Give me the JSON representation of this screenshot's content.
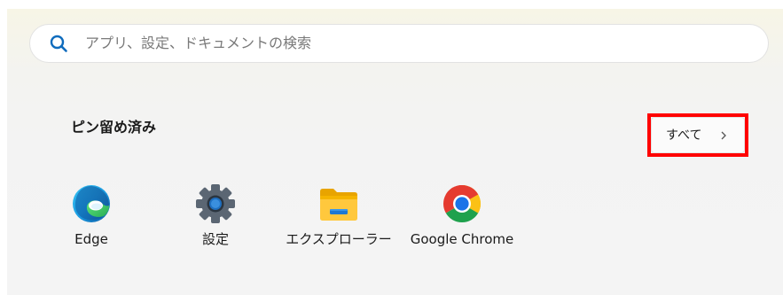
{
  "search": {
    "placeholder": "アプリ、設定、ドキュメントの検索",
    "icon": "search-icon"
  },
  "pinned": {
    "title": "ピン留め済み",
    "all_button_label": "すべて",
    "all_button_icon": "chevron-right-icon",
    "apps": [
      {
        "label": "Edge",
        "icon": "edge-icon"
      },
      {
        "label": "設定",
        "icon": "settings-gear-icon"
      },
      {
        "label": "エクスプローラー",
        "icon": "folder-icon"
      },
      {
        "label": "Google Chrome",
        "icon": "chrome-icon"
      }
    ]
  },
  "colors": {
    "highlight": "#ff0000",
    "accent": "#0f6cbd"
  }
}
